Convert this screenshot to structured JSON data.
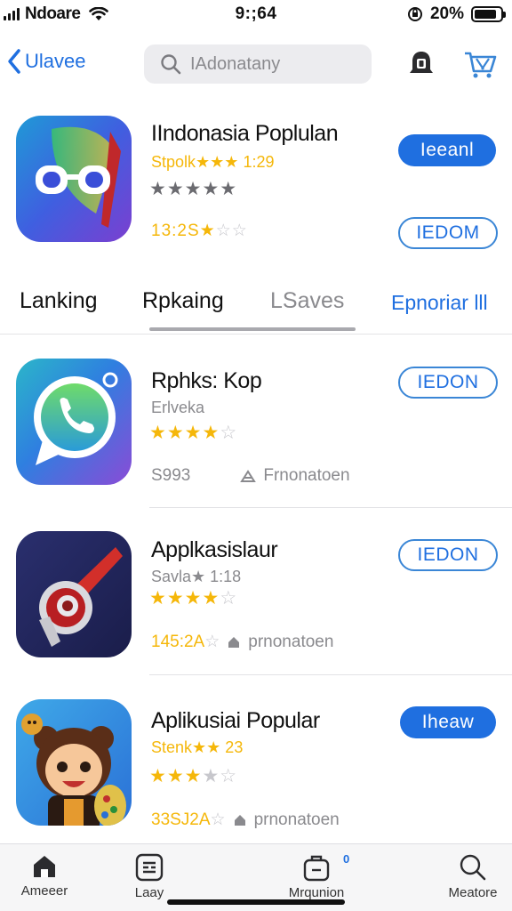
{
  "status_bar": {
    "carrier": "Ndoare",
    "time": "9:;64",
    "battery_text": "20%",
    "battery_level": 0.85,
    "icons": [
      "signal-icon",
      "wifi-icon",
      "lock-rotation-icon",
      "battery-icon"
    ]
  },
  "navbar": {
    "back_label": "Ulavee",
    "search_placeholder": "IAdonatany",
    "icons": [
      "chevron-left-icon",
      "search-icon",
      "bell-icon",
      "cart-icon"
    ]
  },
  "featured": {
    "title": "IIndonasia Poplulan",
    "subtitle": "Stpolk★★★ 1:29",
    "rating_stars": 5,
    "rating_stars_filled": 5,
    "price": "13:2S",
    "price_stars_filled": 1,
    "price_stars_total": 3,
    "primary_button": "Ieeanl",
    "secondary_button": "IEDOM",
    "icon": "glasses-app-icon"
  },
  "tabs": [
    {
      "label": "Lanking",
      "active": false
    },
    {
      "label": "Rpkaing",
      "active": true
    },
    {
      "label": "LSaves",
      "active": false
    },
    {
      "label": "Epnoriar lll",
      "active": false
    }
  ],
  "apps": [
    {
      "title": "Rphks: Kop",
      "subtitle": "Erlveka",
      "stars_filled": 4,
      "stars_total": 5,
      "price": "S993",
      "meta_label": "Frnonatoen",
      "meta_icon": "person-badge-icon",
      "button": "IEDON",
      "button_style": "outline",
      "icon": "chat-app-icon"
    },
    {
      "title": "Applkasislaur",
      "subtitle": "Savla★ 1:18",
      "stars_filled": 4,
      "stars_total": 5,
      "price": "145:2A",
      "price_stars_filled": 0,
      "price_stars_total": 1,
      "meta_label": "prnonatoen",
      "meta_icon": "home-small-icon",
      "button": "IEDON",
      "button_style": "outline",
      "icon": "whistle-app-icon"
    },
    {
      "title": "Aplikusiai Popular",
      "subtitle": "Stenk★★ 23",
      "stars_filled": 3,
      "stars_total": 5,
      "price": "33SJ2A",
      "price_stars_filled": 0,
      "price_stars_total": 1,
      "meta_label": "prnonatoen",
      "meta_icon": "home-small-icon",
      "button": "Iheaw",
      "button_style": "filled",
      "icon": "character-app-icon"
    }
  ],
  "tabbar": {
    "items": [
      {
        "label": "Ameeer",
        "icon": "home-icon",
        "active": true
      },
      {
        "label": "Laay",
        "icon": "list-icon",
        "active": false
      },
      {
        "label": "Mrqunion",
        "icon": "briefcase-icon",
        "active": false
      },
      {
        "label": "Meatore",
        "icon": "search-icon",
        "active": false
      }
    ],
    "badge": "0"
  },
  "colors": {
    "accent": "#1f6fe0",
    "star": "#f5b70a",
    "muted": "#8a8a8e"
  }
}
